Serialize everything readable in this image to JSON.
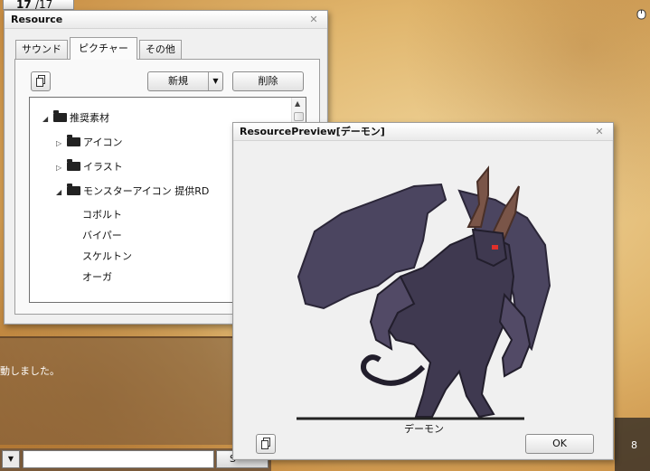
{
  "top_counter": {
    "current": "17",
    "separator": "/",
    "total": "17"
  },
  "resource_window": {
    "title": "Resource",
    "close_glyph": "✕",
    "tabs": [
      {
        "label": "サウンド",
        "active": false
      },
      {
        "label": "ピクチャー",
        "active": true
      },
      {
        "label": "その他",
        "active": false
      }
    ],
    "buttons": {
      "new_label": "新規",
      "delete_label": "削除"
    },
    "tree": [
      {
        "label": "推奨素材",
        "type": "folder",
        "expanded": true,
        "depth": 0
      },
      {
        "label": "アイコン",
        "type": "folder",
        "expanded": false,
        "depth": 1
      },
      {
        "label": "イラスト",
        "type": "folder",
        "expanded": false,
        "depth": 1
      },
      {
        "label": "モンスターアイコン 提供RD",
        "type": "folder",
        "expanded": true,
        "depth": 1
      },
      {
        "label": "コボルト",
        "type": "item",
        "depth": 2
      },
      {
        "label": "バイパー",
        "type": "item",
        "depth": 2
      },
      {
        "label": "スケルトン",
        "type": "item",
        "depth": 2
      },
      {
        "label": "オーガ",
        "type": "item",
        "depth": 2
      }
    ]
  },
  "log": {
    "message": "動しました。"
  },
  "chat": {
    "send_label": "S"
  },
  "side_panel": {
    "number": "8"
  },
  "preview_window": {
    "title": "ResourcePreview[デーモン]",
    "close_glyph": "✕",
    "caption": "デーモン",
    "ok_label": "OK"
  },
  "colors": {
    "demon_body": "#3f3950",
    "demon_wing": "#4b4560",
    "demon_horn": "#7a5548",
    "demon_eye": "#e0302a",
    "parchment": "#e0b56c"
  }
}
